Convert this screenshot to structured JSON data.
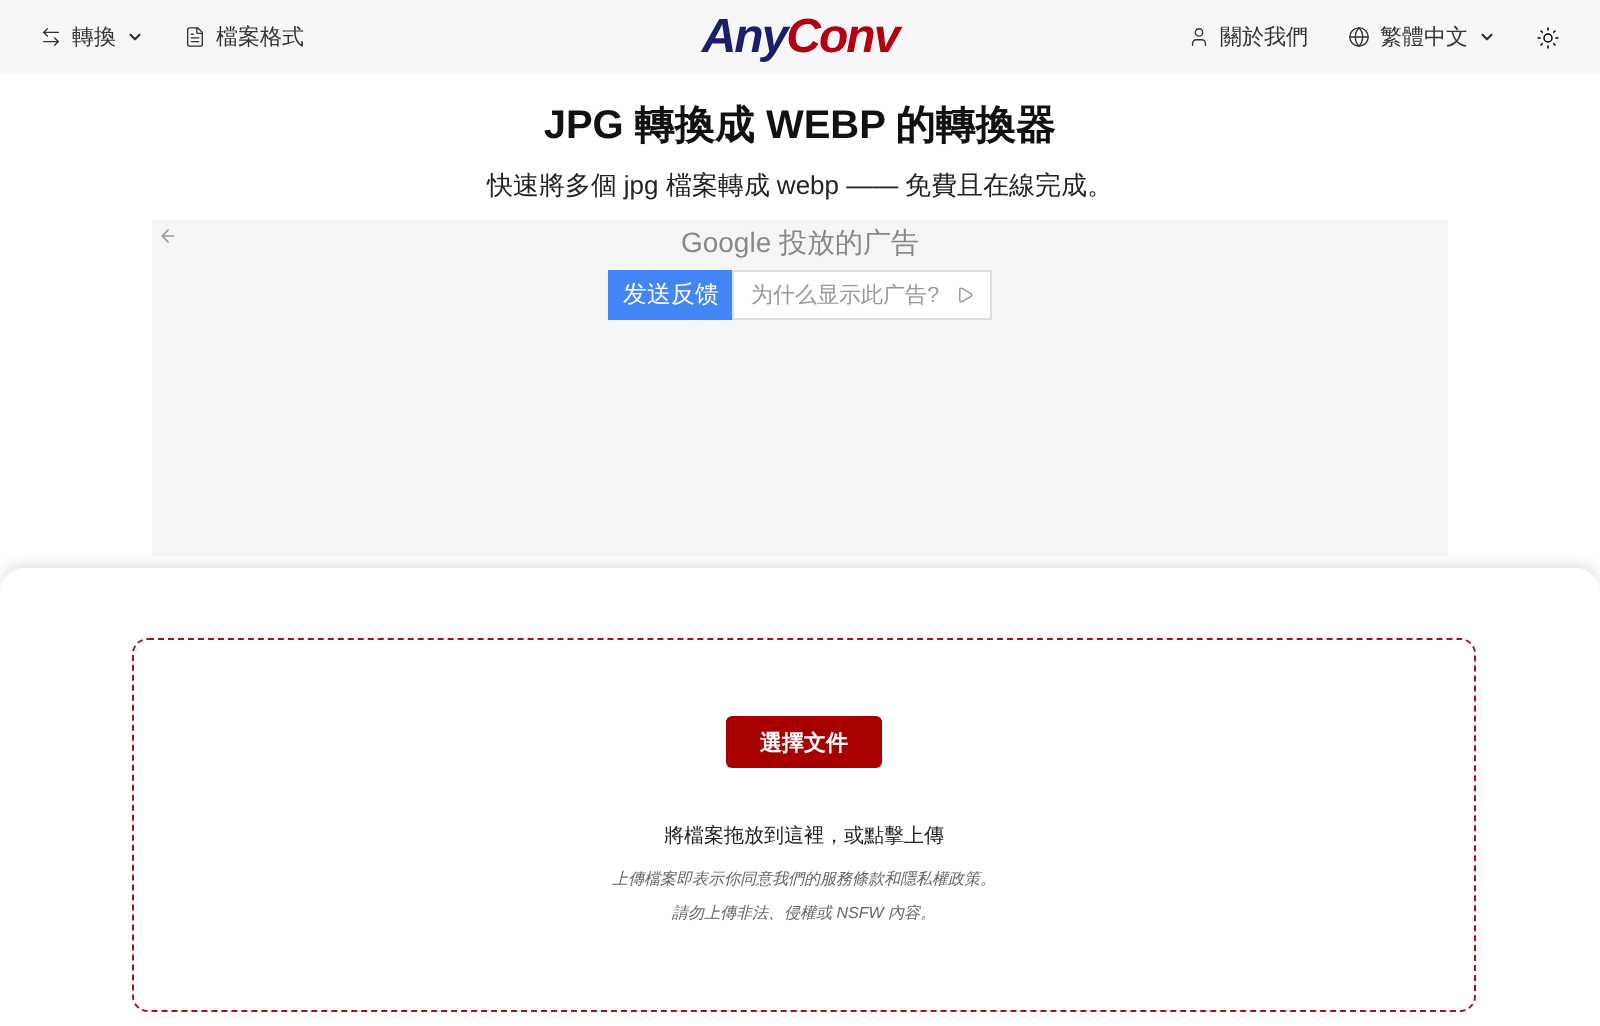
{
  "header": {
    "left": [
      {
        "label": "轉換",
        "dropdown": true
      },
      {
        "label": "檔案格式",
        "dropdown": false
      }
    ],
    "logo": {
      "first": "Any",
      "second": "Conv"
    },
    "right": [
      {
        "label": "關於我們",
        "dropdown": false
      },
      {
        "label": "繁體中文",
        "dropdown": true
      }
    ]
  },
  "title": "JPG 轉換成 WEBP 的轉換器",
  "subtitle": "快速將多個 jpg 檔案轉成 webp —— 免費且在線完成。",
  "ad": {
    "heading": "Google 投放的广告",
    "feedback": "发送反馈",
    "why": "为什么显示此广告?"
  },
  "upload": {
    "button": "選擇文件",
    "hint": "將檔案拖放到這裡，或點擊上傳",
    "notes": [
      "上傳檔案即表示你同意我們的服務條款和隱私權政策。",
      "請勿上傳非法、侵權或 NSFW 內容。"
    ]
  }
}
